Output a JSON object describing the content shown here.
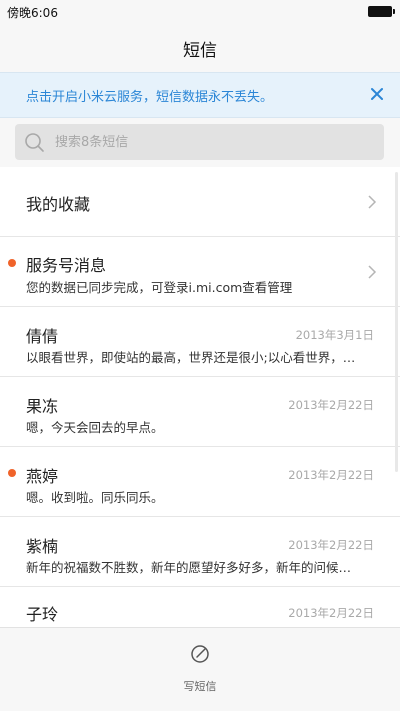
{
  "status_bar": {
    "time": "傍晚6:06"
  },
  "header": {
    "title": "短信"
  },
  "cloud_banner": {
    "text": "点击开启小米云服务，短信数据永不丢失。",
    "close_icon": "close-icon"
  },
  "search": {
    "placeholder": "搜索8条短信",
    "icon": "search-icon"
  },
  "list": {
    "favorites": {
      "name": "我的收藏"
    },
    "service": {
      "name": "服务号消息",
      "preview": "您的数据已同步完成，可登录i.mi.com查看管理",
      "unread": true
    },
    "messages": [
      {
        "name": "倩倩",
        "date": "2013年3月1日",
        "preview": "以眼看世界，即使站的最高，世界还是很小;以心看世界，…",
        "unread": false
      },
      {
        "name": "果冻",
        "date": "2013年2月22日",
        "preview": "嗯，今天会回去的早点。",
        "unread": false
      },
      {
        "name": "燕婷",
        "date": "2013年2月22日",
        "preview": "嗯。收到啦。同乐同乐。",
        "unread": true
      },
      {
        "name": "紫楠",
        "date": "2013年2月22日",
        "preview": "新年的祝福数不胜数，新年的愿望好多好多，新年的问候…",
        "unread": false
      },
      {
        "name": "子玲",
        "date": "2013年2月22日",
        "preview": "",
        "unread": false
      }
    ]
  },
  "bottom_bar": {
    "compose_label": "写短信",
    "compose_icon": "compose-icon"
  },
  "colors": {
    "accent_blue": "#2b86d6",
    "banner_bg": "#e6f2fb",
    "unread_dot": "#f0632a",
    "date_gray": "#a9a9a9"
  }
}
